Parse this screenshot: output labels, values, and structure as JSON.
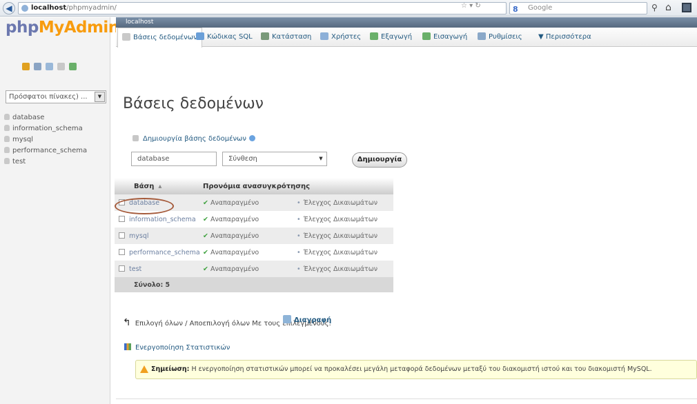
{
  "browser": {
    "url_host": "localhost",
    "url_path": "/phpmyadmin/",
    "search_placeholder": "Google",
    "icons": [
      "back-icon",
      "globe-icon",
      "star-icon",
      "refresh-icon",
      "search-icon",
      "home-icon",
      "bookmarks-icon"
    ]
  },
  "logo": {
    "php": "php",
    "myadmin": "MyAdmin"
  },
  "leftnav": {
    "recent_select": "Πρόσφατοι πίνακες) ...",
    "databases": [
      "database",
      "information_schema",
      "mysql",
      "performance_schema",
      "test"
    ]
  },
  "serverbar": {
    "label": "localhost"
  },
  "tabs": [
    {
      "label": "Βάσεις δεδομένων",
      "icon": "database-icon",
      "color": "#c9c9c9"
    },
    {
      "label": "Κώδικας SQL",
      "icon": "sql-icon",
      "color": "#6a9fd8"
    },
    {
      "label": "Κατάσταση",
      "icon": "status-icon",
      "color": "#7a9a7a"
    },
    {
      "label": "Χρήστες",
      "icon": "users-icon",
      "color": "#8db0d8"
    },
    {
      "label": "Εξαγωγή",
      "icon": "export-icon",
      "color": "#6ab06a"
    },
    {
      "label": "Εισαγωγή",
      "icon": "import-icon",
      "color": "#6ab06a"
    },
    {
      "label": "Ρυθμίσεις",
      "icon": "settings-icon",
      "color": "#8aa8c8"
    },
    {
      "label": "Περισσότερα",
      "icon": "more-icon",
      "color": "#ffffff"
    }
  ],
  "main": {
    "title": "Βάσεις δεδομένων",
    "create_label": "Δημιουργία βάσης δεδομένων",
    "dbname_value": "database",
    "collation_value": "Σύνθεση",
    "create_button": "Δημιουργία",
    "table": {
      "headers": [
        "Βάση",
        "Προνόμια ανασυγκρότησης"
      ],
      "rows": [
        {
          "name": "database",
          "replication": "Αναπαραγμένο",
          "privileges": "Έλεγχος Δικαιωμάτων"
        },
        {
          "name": "information_schema",
          "replication": "Αναπαραγμένο",
          "privileges": "Έλεγχος Δικαιωμάτων"
        },
        {
          "name": "mysql",
          "replication": "Αναπαραγμένο",
          "privileges": "Έλεγχος Δικαιωμάτων"
        },
        {
          "name": "performance_schema",
          "replication": "Αναπαραγμένο",
          "privileges": "Έλεγχος Δικαιωμάτων"
        },
        {
          "name": "test",
          "replication": "Αναπαραγμένο",
          "privileges": "Έλεγχος Δικαιωμάτων"
        }
      ],
      "total_label": "Σύνολο: 5"
    },
    "check_all_text": "Επιλογή όλων / Αποεπιλογή όλων Με τους επιλεγμένους:",
    "drop_button": "Διαγραφή",
    "stats_link": "Ενεργοποίηση Στατιστικών",
    "notice_prefix": "Σημείωση:",
    "notice_text": "Η ενεργοποίηση στατιστικών μπορεί να προκαλέσει μεγάλη μεταφορά δεδομένων μεταξύ του διακομιστή ιστού και του διακομιστή MySQL."
  }
}
